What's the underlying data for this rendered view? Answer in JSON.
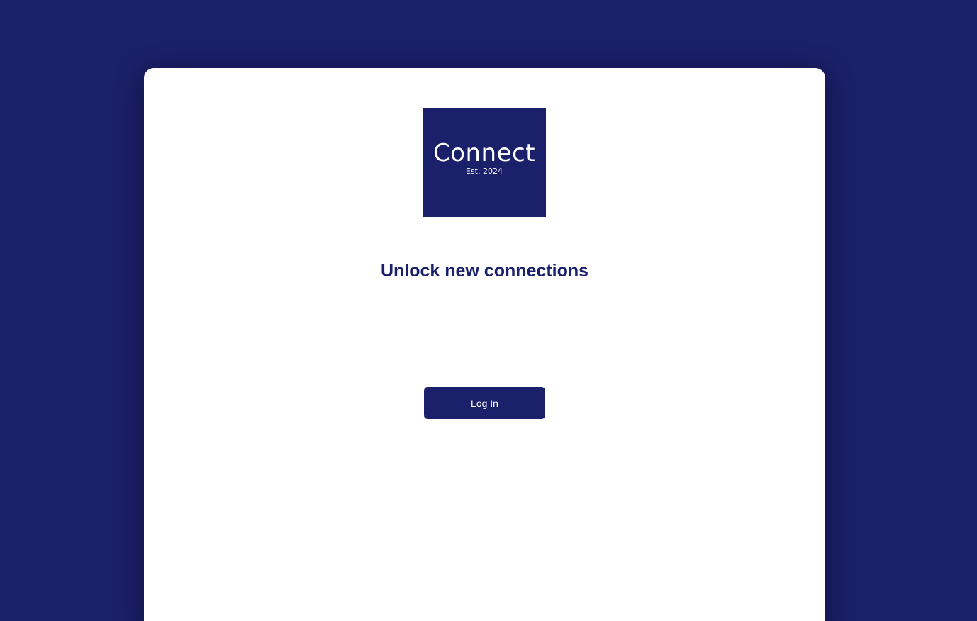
{
  "colors": {
    "background": "#1b206a",
    "card": "#ffffff",
    "brand": "#1b206a",
    "text_on_brand": "#ffffff"
  },
  "logo": {
    "name": "Connect",
    "established": "Est. 2024"
  },
  "headline": "Unlock new connections",
  "login_button": {
    "label": "Log In"
  }
}
